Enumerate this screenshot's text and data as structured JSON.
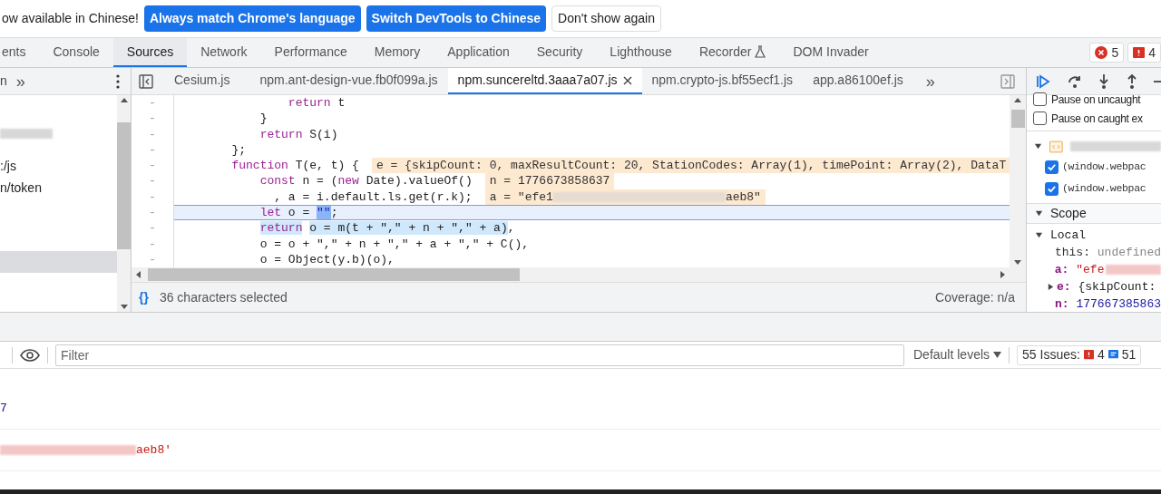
{
  "banner": {
    "message": "ow available in Chinese!",
    "buttons": [
      {
        "label": "Always match Chrome's language",
        "primary": true
      },
      {
        "label": "Switch DevTools to Chinese",
        "primary": true
      },
      {
        "label": "Don't show again",
        "primary": false
      }
    ]
  },
  "main_tabs": [
    {
      "label": "ents",
      "selected": false
    },
    {
      "label": "Console",
      "selected": false
    },
    {
      "label": "Sources",
      "selected": true
    },
    {
      "label": "Network",
      "selected": false
    },
    {
      "label": "Performance",
      "selected": false
    },
    {
      "label": "Memory",
      "selected": false
    },
    {
      "label": "Application",
      "selected": false
    },
    {
      "label": "Security",
      "selected": false
    },
    {
      "label": "Lighthouse",
      "selected": false
    },
    {
      "label": "Recorder",
      "selected": false,
      "flask": true
    },
    {
      "label": "DOM Invader",
      "selected": false
    }
  ],
  "counters": [
    {
      "kind": "error",
      "count": "5"
    },
    {
      "kind": "issue",
      "count": "4"
    }
  ],
  "navigator": {
    "partial": "n",
    "overflow": "»",
    "items": [
      {
        "kind": "redacted",
        "selected": false
      },
      {
        "kind": "text",
        "label": ":/js",
        "selected": false
      },
      {
        "kind": "text",
        "label": "n/token",
        "selected": false
      },
      {
        "kind": "blank",
        "selected": true
      }
    ]
  },
  "editor_tabs": [
    {
      "label": "Cesium.js",
      "selected": false,
      "closable": false
    },
    {
      "label": "npm.ant-design-vue.fb0f099a.js",
      "selected": false,
      "closable": false
    },
    {
      "label": "npm.suncereltd.3aaa7a07.js",
      "selected": true,
      "closable": true
    },
    {
      "label": "npm.crypto-js.bf55ecf1.js",
      "selected": false,
      "closable": false
    },
    {
      "label": "app.a86100ef.js",
      "selected": false,
      "closable": false
    }
  ],
  "editor_overflow": "»",
  "code_lines": [
    {
      "gutter": "-",
      "paused": false,
      "segments": [
        {
          "text": "                return",
          "kind": "keyword",
          "selected": false
        },
        {
          "text": " t",
          "kind": "plain",
          "selected": false
        }
      ]
    },
    {
      "gutter": "-",
      "paused": false,
      "segments": [
        {
          "text": "            }",
          "kind": "plain",
          "selected": false
        }
      ]
    },
    {
      "gutter": "-",
      "paused": false,
      "segments": [
        {
          "text": "            return",
          "kind": "keyword",
          "selected": false
        },
        {
          "text": " S(i)",
          "kind": "plain",
          "selected": false
        }
      ]
    },
    {
      "gutter": "-",
      "paused": false,
      "segments": [
        {
          "text": "        };",
          "kind": "plain",
          "selected": false
        }
      ]
    },
    {
      "gutter": "-",
      "paused": false,
      "segments": [
        {
          "text": "        function",
          "kind": "keyword",
          "selected": false
        },
        {
          "text": " T(e, t) {",
          "kind": "plain",
          "selected": false
        }
      ],
      "inline_value": [
        {
          "kind": "text",
          "text": "e = {skipCount: 0, maxResultCount: 20, StationCodes: Array(1), timePoint: Array(2), DataT"
        }
      ]
    },
    {
      "gutter": "-",
      "paused": false,
      "segments": [
        {
          "text": "            const",
          "kind": "keyword",
          "selected": false
        },
        {
          "text": " n = (",
          "kind": "plain",
          "selected": false
        },
        {
          "text": "new",
          "kind": "keyword",
          "selected": false
        },
        {
          "text": " Date).valueOf()",
          "kind": "plain",
          "selected": false
        }
      ],
      "inline_value": [
        {
          "kind": "text",
          "text": "n = 1776673858637"
        }
      ]
    },
    {
      "gutter": "-",
      "paused": false,
      "segments": [
        {
          "text": "              , a = i.default.ls.get(r.k);",
          "kind": "plain",
          "selected": false
        }
      ],
      "inline_value": [
        {
          "kind": "text",
          "text": "a = \"efe1"
        },
        {
          "kind": "redacted"
        },
        {
          "kind": "text",
          "text": "aeb8\""
        }
      ]
    },
    {
      "gutter": "-",
      "paused": true,
      "segments": [
        {
          "text": "            let",
          "kind": "keyword",
          "selected": false
        },
        {
          "text": " o = ",
          "kind": "plain",
          "selected": false
        },
        {
          "text": "\"\"",
          "kind": "string",
          "selected": true
        },
        {
          "text": ";",
          "kind": "plain",
          "selected": false
        }
      ]
    },
    {
      "gutter": "-",
      "paused": false,
      "segments": [
        {
          "text": "            return",
          "kind": "keyword",
          "selected": true
        },
        {
          "text": " o = m(t + \",\" + n + \",\" + a)",
          "kind": "plain",
          "selected": true
        },
        {
          "text": ",",
          "kind": "plain",
          "selected": false
        }
      ]
    },
    {
      "gutter": "-",
      "paused": false,
      "segments": [
        {
          "text": "            o = o + \",\" + n + \",\" + a + \",\" + C(),",
          "kind": "plain",
          "selected": false
        }
      ]
    },
    {
      "gutter": "-",
      "paused": false,
      "segments": [
        {
          "text": "            o = Object(y.b)(o),",
          "kind": "plain",
          "selected": false
        }
      ]
    }
  ],
  "editor_status": {
    "pretty_print": "{}",
    "selection": "36 characters selected",
    "coverage": "Coverage: n/a"
  },
  "debugger": {
    "checkboxes": [
      {
        "label": "Pause on uncaught",
        "checked": false
      },
      {
        "label": "Pause on caught ex",
        "checked": false
      }
    ],
    "breakpoint_group": {
      "expanded": true,
      "items": [
        {
          "label": "(window.webpac",
          "checked": true
        },
        {
          "label": "(window.webpac",
          "checked": true
        }
      ]
    },
    "scope": {
      "label": "Scope",
      "expanded": true,
      "local": {
        "label": "Local",
        "expanded": true,
        "vars": [
          {
            "name": "this:",
            "value": "undefined",
            "kind": "undefined",
            "expandable": false
          },
          {
            "name": "a:",
            "value": "\"efe",
            "kind": "string",
            "expandable": false,
            "redacted": true
          },
          {
            "name": "e:",
            "value": "{skipCount:",
            "kind": "object",
            "expandable": true
          },
          {
            "name": "n:",
            "value": "177667385863",
            "kind": "number",
            "expandable": false
          }
        ]
      }
    }
  },
  "console": {
    "filter_placeholder": "Filter",
    "levels": "Default levels",
    "issues": {
      "label": "55 Issues:",
      "errors": "4",
      "infos": "51"
    },
    "lines": [
      {
        "kind": "number",
        "text": "7",
        "redacted": false
      },
      {
        "kind": "string",
        "text": "aeb8'",
        "redacted": true
      }
    ]
  }
}
